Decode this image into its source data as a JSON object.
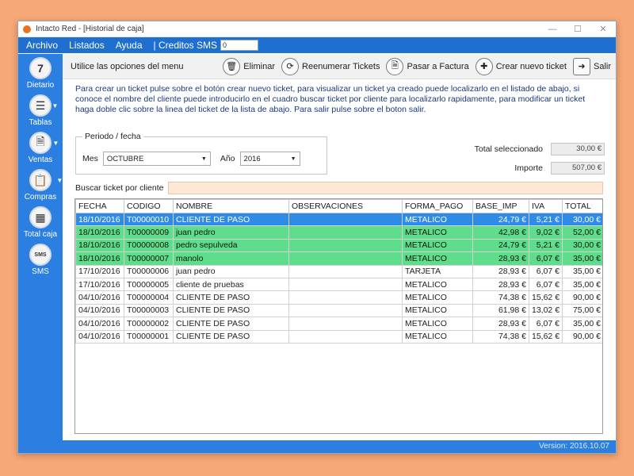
{
  "window": {
    "title": "Intacto Red - [Historial de caja]",
    "minimize": "—",
    "maximize": "☐",
    "close": "✕"
  },
  "menu": {
    "archivo": "Archivo",
    "listados": "Listados",
    "ayuda": "Ayuda",
    "creditos": "| Creditos SMS",
    "creditos_value": "0"
  },
  "sidebar": [
    {
      "label": "Dietario",
      "icon": "calendar-icon",
      "glyph": "7"
    },
    {
      "label": "Tablas",
      "icon": "list-icon",
      "glyph": "☰"
    },
    {
      "label": "Ventas",
      "icon": "sales-document-icon",
      "glyph": "🗎"
    },
    {
      "label": "Compras",
      "icon": "clipboard-icon",
      "glyph": "📋"
    },
    {
      "label": "Total caja",
      "icon": "calculator-icon",
      "glyph": "▦"
    },
    {
      "label": "SMS",
      "icon": "sms-icon",
      "glyph": "SMS"
    }
  ],
  "toolbar": {
    "hint": "Utilice las opciones del menu",
    "eliminar": "Eliminar",
    "reenumerar": "Reenumerar Tickets",
    "pasar": "Pasar a Factura",
    "crear": "Crear nuevo ticket",
    "salir": "Salir"
  },
  "description": "Para crear un ticket pulse sobre el botón crear nuevo ticket, para visualizar un ticket ya creado puede localizarlo en el listado de abajo, si conoce el nombre del cliente puede introducirlo en el cuadro buscar ticket por cliente para localizarlo rapidamente, para modificar un ticket haga doble clic sobre la linea del ticket de la lista de abajo. Para salir pulse sobre el boton salir.",
  "filters": {
    "legend": "Periodo / fecha",
    "mes_label": "Mes",
    "mes_value": "OCTUBRE",
    "anio_label": "Año",
    "anio_value": "2016"
  },
  "totals": {
    "seleccionado_label": "Total seleccionado",
    "seleccionado_value": "30,00 €",
    "importe_label": "Importe",
    "importe_value": "507,00 €"
  },
  "search": {
    "label": "Buscar ticket por cliente",
    "value": ""
  },
  "table": {
    "headers": [
      "FECHA",
      "CODIGO",
      "NOMBRE",
      "OBSERVACIONES",
      "FORMA_PAGO",
      "BASE_IMP",
      "IVA",
      "TOTAL"
    ],
    "rows": [
      {
        "state": "sel",
        "cells": [
          "18/10/2016",
          "T00000010",
          "CLIENTE DE PASO",
          "",
          "METALICO",
          "24,79 €",
          "5,21 €",
          "30,00 €"
        ]
      },
      {
        "state": "green",
        "cells": [
          "18/10/2016",
          "T00000009",
          "juan pedro",
          "",
          "METALICO",
          "42,98 €",
          "9,02 €",
          "52,00 €"
        ]
      },
      {
        "state": "green",
        "cells": [
          "18/10/2016",
          "T00000008",
          "pedro sepulveda",
          "",
          "METALICO",
          "24,79 €",
          "5,21 €",
          "30,00 €"
        ]
      },
      {
        "state": "green",
        "cells": [
          "18/10/2016",
          "T00000007",
          "manolo",
          "",
          "METALICO",
          "28,93 €",
          "6,07 €",
          "35,00 €"
        ]
      },
      {
        "state": "normal",
        "cells": [
          "17/10/2016",
          "T00000006",
          "juan pedro",
          "",
          "TARJETA",
          "28,93 €",
          "6,07 €",
          "35,00 €"
        ]
      },
      {
        "state": "normal",
        "cells": [
          "17/10/2016",
          "T00000005",
          "cliente de pruebas",
          "",
          "METALICO",
          "28,93 €",
          "6,07 €",
          "35,00 €"
        ]
      },
      {
        "state": "normal",
        "cells": [
          "04/10/2016",
          "T00000004",
          "CLIENTE DE PASO",
          "",
          "METALICO",
          "74,38 €",
          "15,62 €",
          "90,00 €"
        ]
      },
      {
        "state": "normal",
        "cells": [
          "04/10/2016",
          "T00000003",
          "CLIENTE DE PASO",
          "",
          "METALICO",
          "61,98 €",
          "13,02 €",
          "75,00 €"
        ]
      },
      {
        "state": "normal",
        "cells": [
          "04/10/2016",
          "T00000002",
          "CLIENTE DE PASO",
          "",
          "METALICO",
          "28,93 €",
          "6,07 €",
          "35,00 €"
        ]
      },
      {
        "state": "normal",
        "cells": [
          "04/10/2016",
          "T00000001",
          "CLIENTE DE PASO",
          "",
          "METALICO",
          "74,38 €",
          "15,62 €",
          "90,00 €"
        ]
      }
    ]
  },
  "status": {
    "version": "Version: 2016.10.07"
  },
  "colors": {
    "accent": "#2b7fe0",
    "selected_row": "#2f8be8",
    "green_row": "#5fdc8c",
    "search_bg": "#fde8d6"
  }
}
